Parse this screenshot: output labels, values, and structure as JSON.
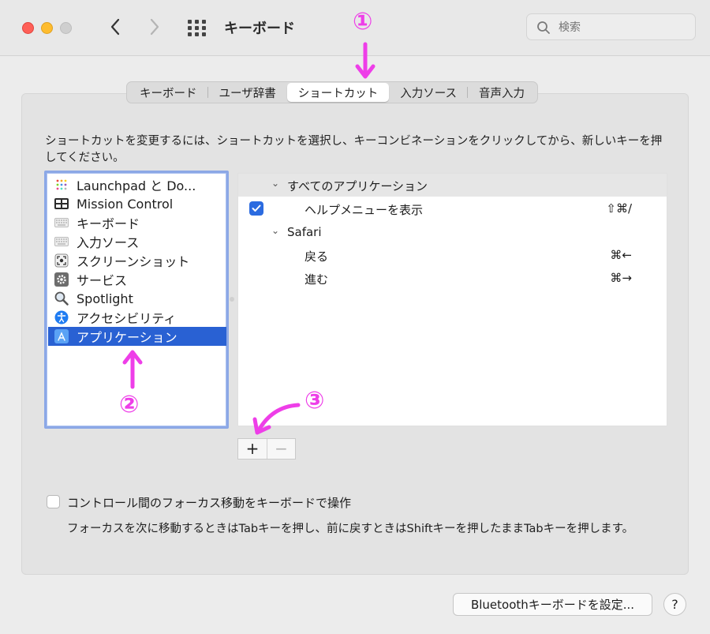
{
  "window": {
    "title": "キーボード"
  },
  "search": {
    "placeholder": "検索"
  },
  "tabs": [
    {
      "label": "キーボード"
    },
    {
      "label": "ユーザ辞書"
    },
    {
      "label": "ショートカット",
      "active": true
    },
    {
      "label": "入力ソース"
    },
    {
      "label": "音声入力"
    }
  ],
  "instructions": "ショートカットを変更するには、ショートカットを選択し、キーコンビネーションをクリックしてから、新しいキーを押してください。",
  "categories": [
    {
      "label": "Launchpad と Do...",
      "icon": "launchpad-icon"
    },
    {
      "label": "Mission Control",
      "icon": "mission-control-icon"
    },
    {
      "label": "キーボード",
      "icon": "keyboard-icon"
    },
    {
      "label": "入力ソース",
      "icon": "keyboard-icon"
    },
    {
      "label": "スクリーンショット",
      "icon": "screenshot-icon"
    },
    {
      "label": "サービス",
      "icon": "gear-icon"
    },
    {
      "label": "Spotlight",
      "icon": "magnifier-icon"
    },
    {
      "label": "アクセシビリティ",
      "icon": "accessibility-icon"
    },
    {
      "label": "アプリケーション",
      "icon": "app-store-icon",
      "selected": true
    }
  ],
  "shortcuts": {
    "all_apps_header": "すべてのアプリケーション",
    "help_menu": {
      "label": "ヘルプメニューを表示",
      "key": "⇧⌘/",
      "checked": true
    },
    "safari_header": "Safari",
    "back": {
      "label": "戻る",
      "key": "⌘←"
    },
    "forward": {
      "label": "進む",
      "key": "⌘→"
    }
  },
  "buttons": {
    "add": "+",
    "remove": "−"
  },
  "focus": {
    "label": "コントロール間のフォーカス移動をキーボードで操作",
    "checked": false,
    "description": "フォーカスを次に移動するときはTabキーを押し、前に戻すときはShiftキーを押したままTabキーを押します。"
  },
  "bluetooth_button": "Bluetoothキーボードを設定...",
  "help_button": "?",
  "annotations": [
    "①",
    "②",
    "③"
  ],
  "colors": {
    "accent": "#2961d3",
    "annotation": "#ee3ee8",
    "selection_border": "#8ca8e6"
  }
}
